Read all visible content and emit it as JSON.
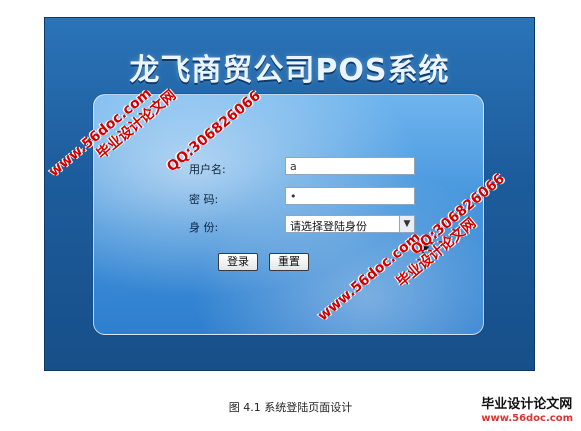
{
  "app": {
    "title": "龙飞商贸公司POS系统"
  },
  "login": {
    "username_label": "用户名:",
    "username_value": "a",
    "password_label": "密 码:",
    "password_value": "•",
    "role_label": "身 份:",
    "role_selected": "请选择登陆身份",
    "login_button": "登录",
    "reset_button": "重置"
  },
  "caption": "图 4.1 系统登陆页面设计",
  "watermarks": {
    "wm1": "毕业设计论文网",
    "wm2": "QQ:306826066",
    "wm3": "www.56doc.com"
  },
  "logo": {
    "text": "毕业设计论文网",
    "sub": "www.56doc.com"
  },
  "colors": {
    "screen_bg": "#1d5c9c",
    "panel_bg": "#3c8ed8",
    "watermark": "#d00000"
  }
}
